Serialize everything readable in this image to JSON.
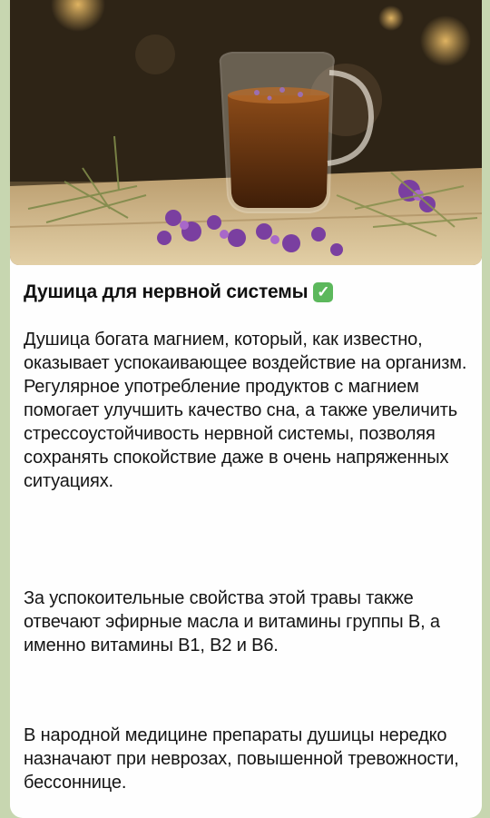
{
  "post": {
    "title": "Душица для нервной системы",
    "title_icon": "check-mark-button-icon",
    "paragraphs": [
      "Душица богата магнием, который, как известно, оказывает успокаивающее воздействие на организм. Регулярное употребление продуктов с магнием помогает улучшить качество сна, а также увеличить стрессоустойчивость нервной системы, позволяя сохранять спокойствие даже в очень напряженных ситуациях.",
      "За успокоительные свойства этой травы также отвечают эфирные масла и витамины группы В, а именно витамины В1, В2 и В6.",
      "В народной медицине препараты душицы нередко назначают при неврозах, повышенной тревожности, бессоннице."
    ]
  },
  "colors": {
    "chat_background": "#c7d6b0",
    "bubble": "#fefefe",
    "check_badge": "#5cb85c"
  }
}
